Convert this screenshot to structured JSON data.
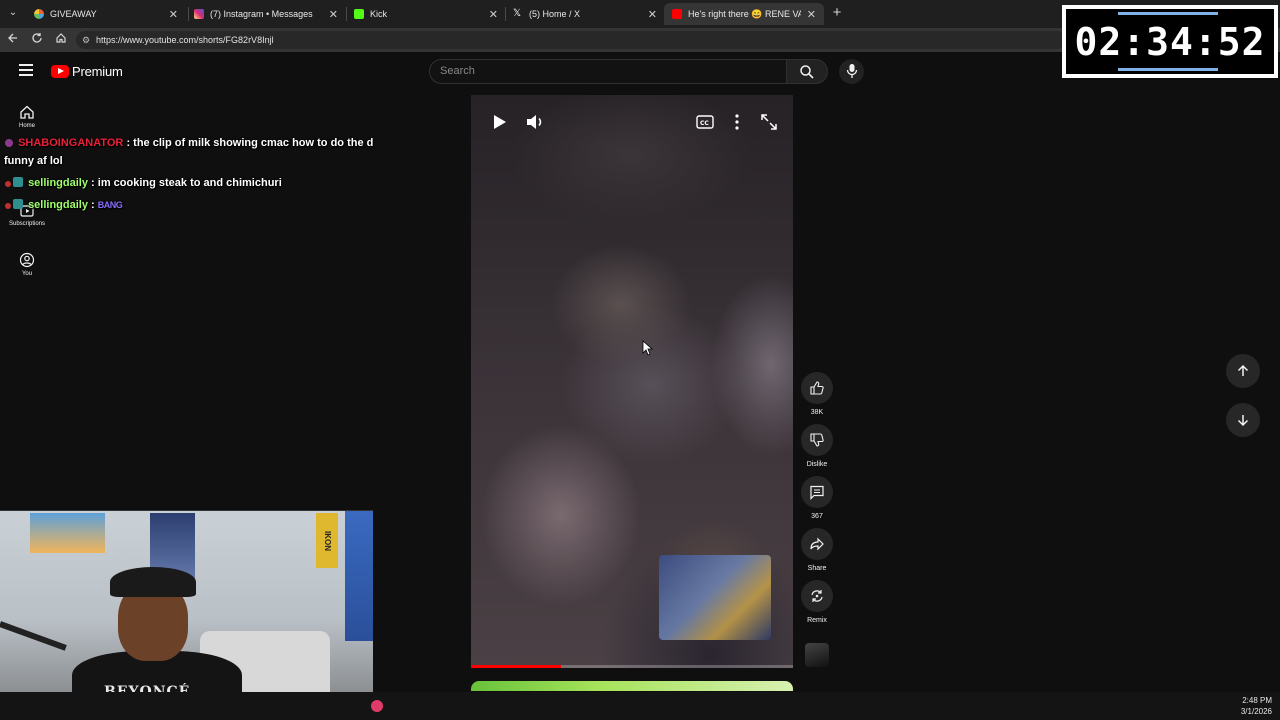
{
  "browser": {
    "tabs": [
      {
        "title": "GIVEAWAY",
        "active": false,
        "icon": "giveaway-icon",
        "color": "#e8643a"
      },
      {
        "title": "(7) Instagram • Messages",
        "active": false,
        "icon": "instagram-icon",
        "color": "#d6249f"
      },
      {
        "title": "Kick",
        "active": false,
        "icon": "kick-icon",
        "color": "#53fc18"
      },
      {
        "title": "(5) Home / X",
        "active": false,
        "icon": "x-icon",
        "color": "#ffffff"
      },
      {
        "title": "He's right there 😄 RENE VACA - Y",
        "active": true,
        "icon": "youtube-icon",
        "color": "#ff0000"
      }
    ],
    "close_glyph": "✕",
    "new_tab_glyph": "+",
    "url": "https://www.youtube.com/shorts/FG82rV8Injl"
  },
  "youtube": {
    "logo_text": "Premium",
    "search_placeholder": "Search",
    "guide": [
      {
        "label": "Home",
        "icon": "home-icon"
      },
      {
        "label": "Subscriptions",
        "icon": "subscriptions-icon"
      },
      {
        "label": "You",
        "icon": "you-icon"
      }
    ],
    "actions": {
      "like": "38K",
      "dislike": "Dislike",
      "comments": "367",
      "share": "Share",
      "remix": "Remix"
    },
    "progress_fraction": 0.28
  },
  "chat": [
    {
      "user": "SHABOINGANATOR",
      "user_color": "#e8203a",
      "message": "the clip of milk showing cmac how to do the d",
      "continuation": "funny af lol"
    },
    {
      "user": "sellingdaily",
      "user_color": "#9fff6a",
      "message": "im cooking steak to and chimichuri"
    },
    {
      "user": "sellingdaily",
      "user_color": "#9fff6a",
      "message": "",
      "emote": "BANG"
    }
  ],
  "timer": {
    "value": "02:34:52"
  },
  "webcam": {
    "shirt_text": "BEYONCÉ",
    "poster_text": "IKON"
  },
  "taskbar": {
    "time": "2:48 PM",
    "date": "3/1/2026"
  }
}
